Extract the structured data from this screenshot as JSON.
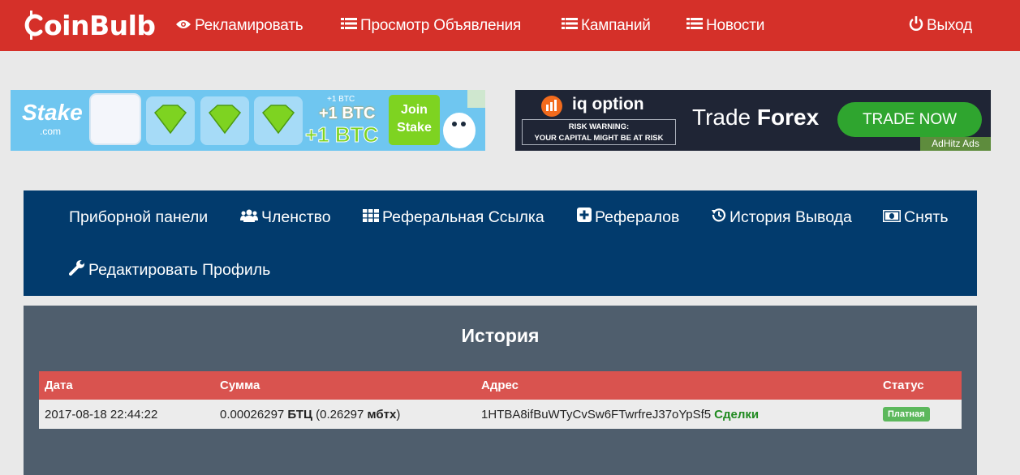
{
  "brand": {
    "name": "oinBulb"
  },
  "topnav": {
    "advertise": "Рекламировать",
    "view_ads": "Просмотр Объявления",
    "campaigns": "Кампаний",
    "news": "Новости",
    "logout": "Выход"
  },
  "ads": {
    "stake": {
      "logo": "Stake",
      "logo_sub": ".com",
      "small_btc": "+1 BTC",
      "btc1": "+1 BTC",
      "btc2": "+1 BTC",
      "join1": "Join",
      "join2": "Stake"
    },
    "iq": {
      "logo": "iq option",
      "warn1": "RISK WARNING:",
      "warn2": "YOUR CAPITAL MIGHT BE AT RISK",
      "headline_a": "Trade ",
      "headline_b": "Forex",
      "cta": "TRADE NOW",
      "network": "AdHitz Ads"
    }
  },
  "dashboard_nav": {
    "dashboard": "Приборной панели",
    "membership": "Членство",
    "referral_link": "Реферальная Ссылка",
    "referrals": "Рефералов",
    "withdraw_history": "История Вывода",
    "withdraw": "Снять",
    "edit_profile": "Редактировать Профиль"
  },
  "history": {
    "title": "История",
    "columns": [
      "Дата",
      "Сумма",
      "Адрес",
      "Статус"
    ],
    "rows": [
      {
        "date": "2017-08-18 22:44:22",
        "amount": "0.00026297",
        "unit": "БТЦ",
        "mbtc": "(0.26297",
        "mbtc_unit": "мбтх",
        "mbtc_close": ")",
        "address": "1HTBA8ifBuWTyCvSw6FTwrfreJ37oYpSf5",
        "deals": "Сделки",
        "status": "Платная"
      }
    ]
  },
  "colors": {
    "topbar": "#d53029",
    "dash_nav": "#023b6d",
    "panel": "#4f5e6d",
    "table_header": "#d9534f",
    "status_paid": "#5cb85c",
    "deals_link": "#1f8a1f"
  }
}
